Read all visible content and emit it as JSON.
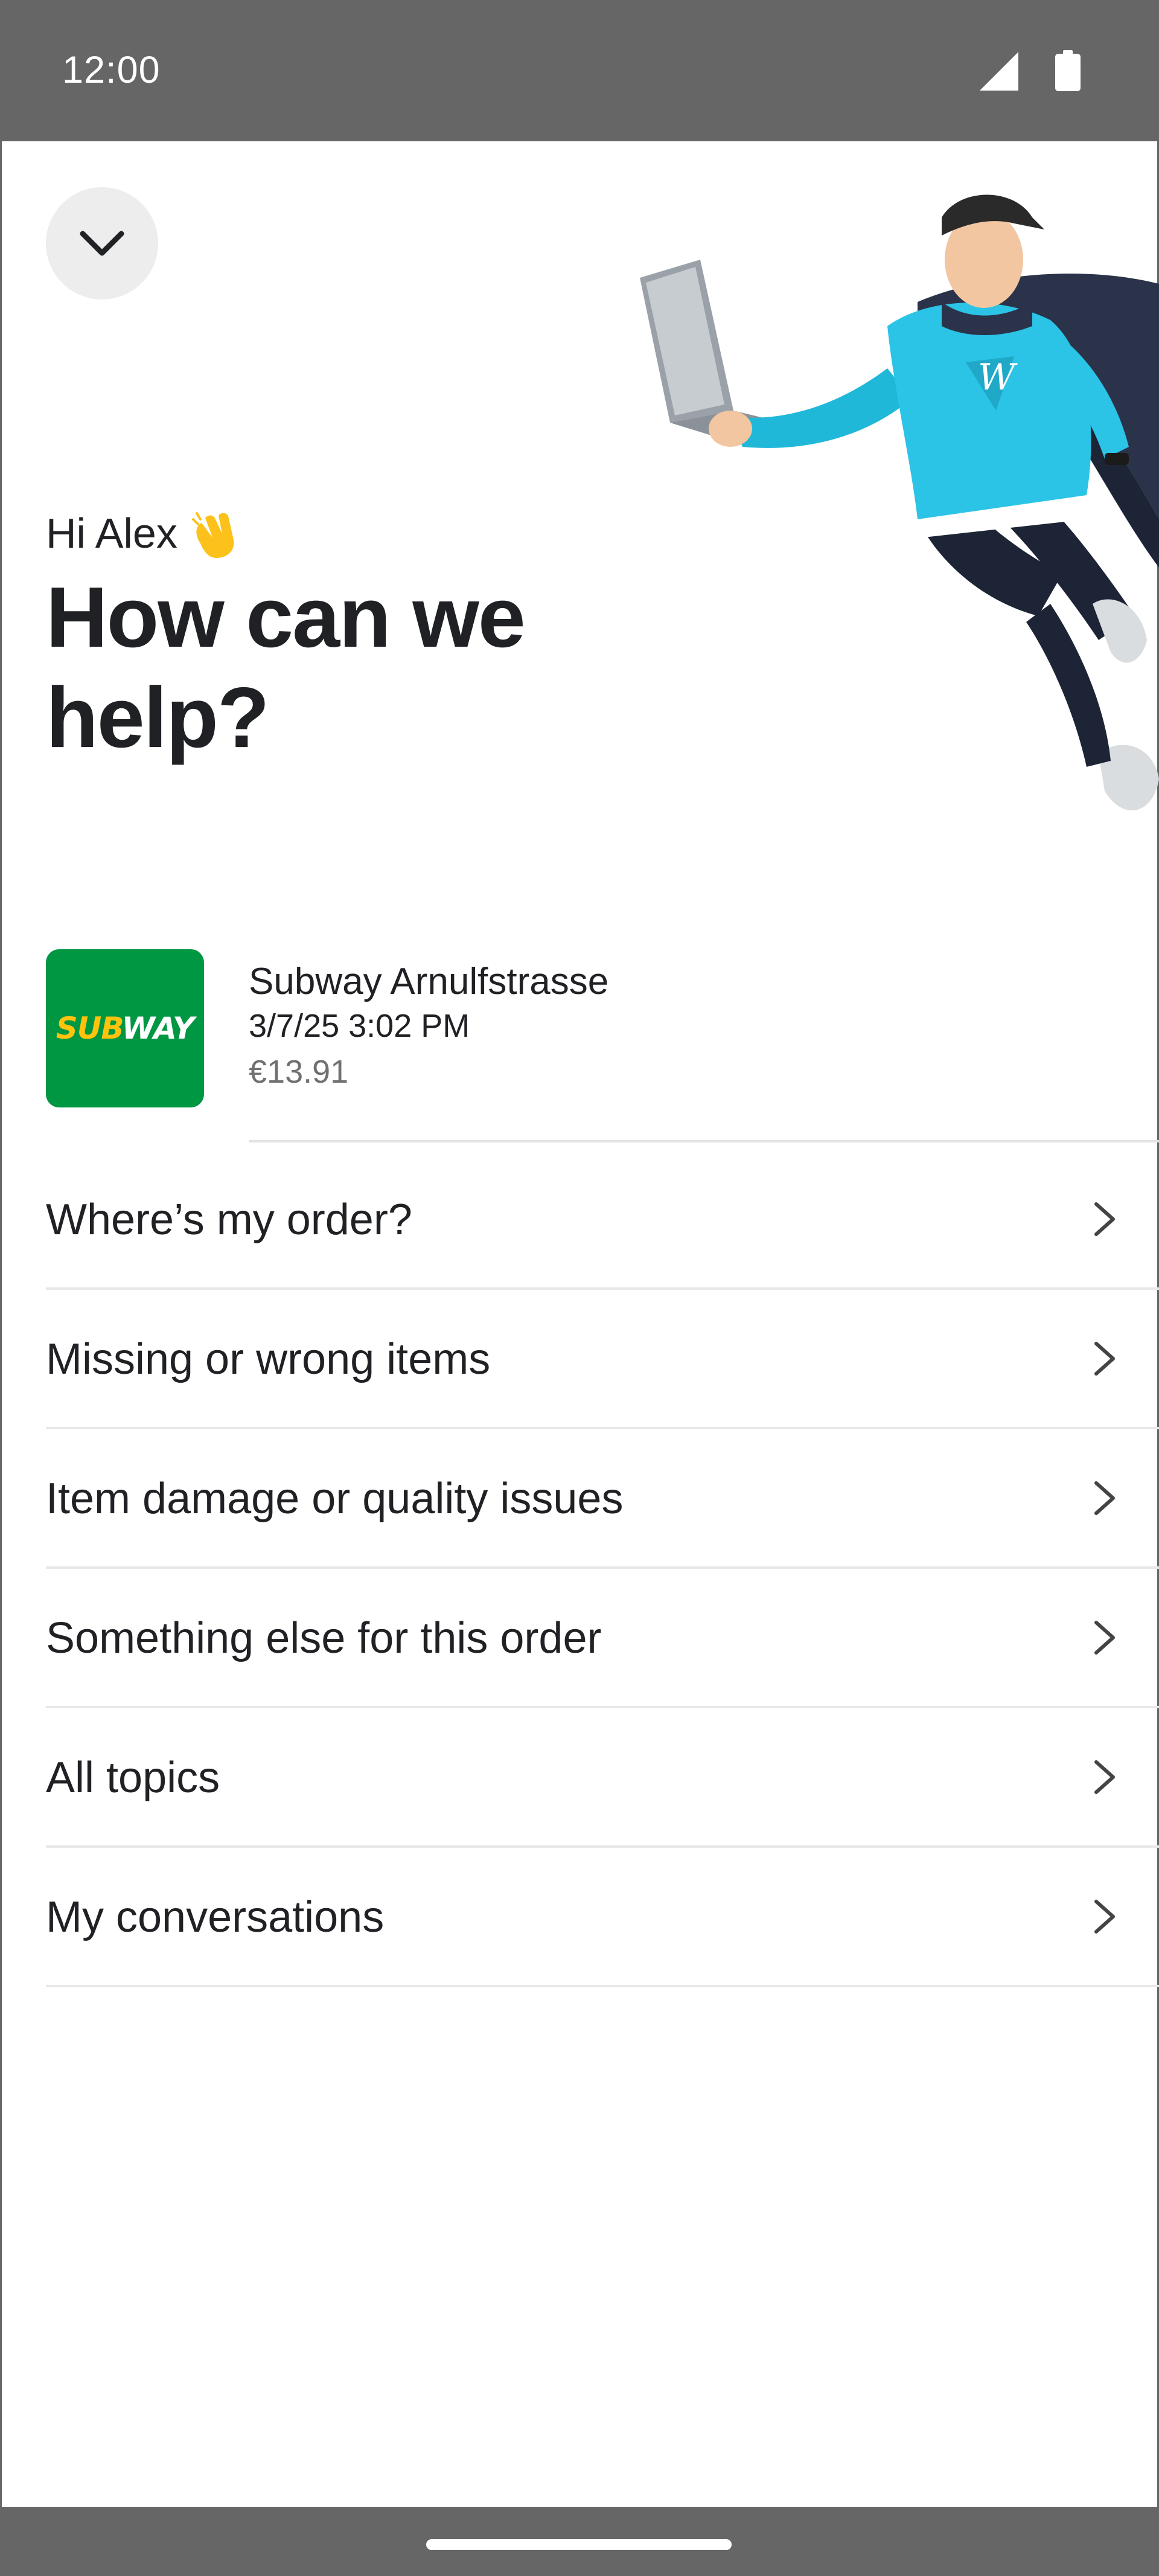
{
  "status_bar": {
    "time": "12:00",
    "icons": [
      "signal-icon",
      "battery-icon"
    ]
  },
  "header": {
    "collapse_icon": "chevron-down-icon",
    "greeting": "Hi Alex",
    "greeting_emoji_icon": "waving-hand-icon",
    "headline": "How can we help?"
  },
  "order": {
    "logo_text_part1": "SUB",
    "logo_text_part2": "WAY",
    "restaurant": "Subway Arnulfstrasse",
    "date": "3/7/25 3:02 PM",
    "price": "€13.91"
  },
  "menu": [
    {
      "label": "Where’s my order?"
    },
    {
      "label": "Missing or wrong items"
    },
    {
      "label": "Item damage or quality issues"
    },
    {
      "label": "Something else for this order"
    },
    {
      "label": "All topics"
    },
    {
      "label": "My conversations"
    }
  ],
  "colors": {
    "status_bar": "#666666",
    "subway_green": "#009743",
    "subway_yellow": "#ffc20d",
    "text_primary": "#202125",
    "text_secondary": "#707070",
    "divider": "#e8e8e8"
  }
}
